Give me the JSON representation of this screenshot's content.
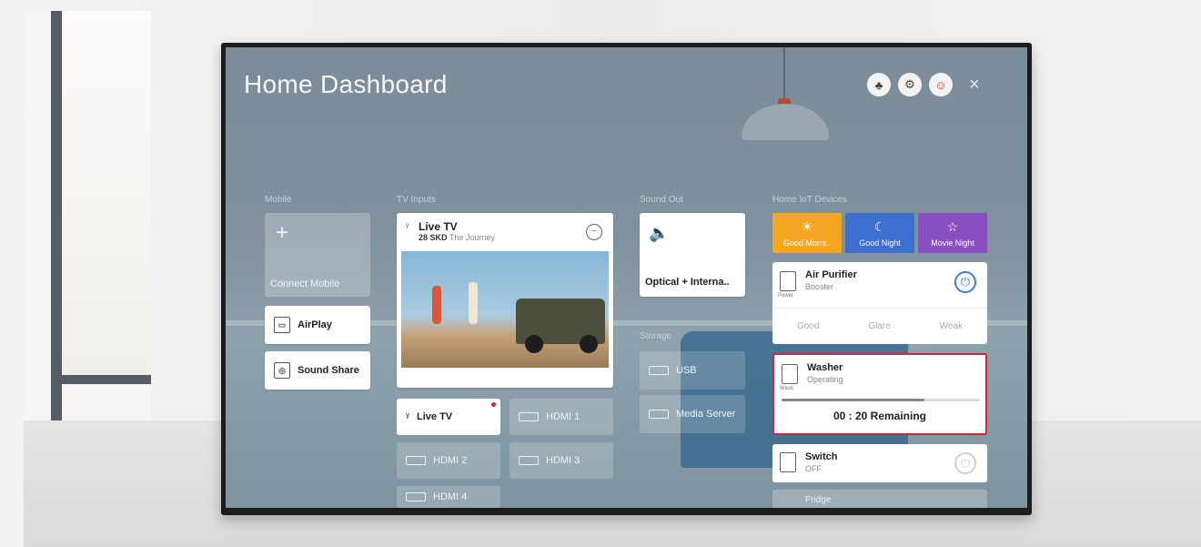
{
  "dashboard": {
    "title": "Home Dashboard",
    "close_glyph": "×",
    "top_icons": [
      "account-icon",
      "settings-icon",
      "profile-icon"
    ]
  },
  "sections": {
    "mobile": "Mobile",
    "tv_inputs": "TV Inputs",
    "sound_out": "Sound Out",
    "storage": "Storage",
    "iot": "Home IoT Devices"
  },
  "mobile": {
    "connect_label": "Connect Mobile",
    "airplay_label": "AirPlay",
    "soundshare_label": "Sound Share"
  },
  "inputs": {
    "livetv_card": {
      "title": "Live TV",
      "channel": "28 SKD",
      "program": "The Journey"
    },
    "sources": [
      {
        "label": "Live TV",
        "active": true
      },
      {
        "label": "HDMI 1",
        "active": false
      },
      {
        "label": "HDMI 2",
        "active": false
      },
      {
        "label": "HDMI 3",
        "active": false
      },
      {
        "label": "HDMI 4",
        "active": false
      }
    ]
  },
  "sound": {
    "output_label": "Optical + Interna.."
  },
  "storage": {
    "usb_label": "USB",
    "media_server_label": "Media Server"
  },
  "iot": {
    "scenes": [
      {
        "label": "Good Morni..",
        "color": "#f5a623",
        "icon": "sun-icon"
      },
      {
        "label": "Good Night",
        "color": "#3d6fcf",
        "icon": "moon-icon"
      },
      {
        "label": "Movie Night",
        "color": "#8a4fc0",
        "icon": "star-icon"
      }
    ],
    "air_purifier": {
      "name": "Air Purifier",
      "status": "Booster",
      "icon_caption": "Power",
      "modes": [
        "Good",
        "Glare",
        "Weak"
      ]
    },
    "washer": {
      "name": "Washer",
      "status": "Operating",
      "icon_caption": "Wash",
      "remaining": "00 : 20 Remaining",
      "progress": 0.72
    },
    "switch": {
      "name": "Switch",
      "status": "OFF"
    },
    "fridge": {
      "name": "Fridge"
    }
  }
}
